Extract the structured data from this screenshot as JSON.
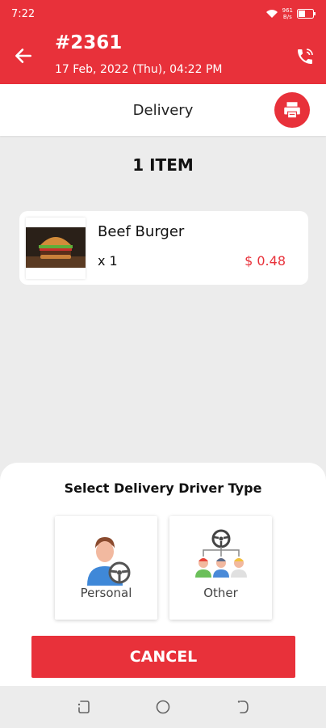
{
  "status_bar": {
    "time": "7:22",
    "speed": "961",
    "speed_unit": "B/s"
  },
  "header": {
    "order_number": "#2361",
    "order_date": "17 Feb, 2022 (Thu), 04:22 PM"
  },
  "subheader": {
    "label": "Delivery"
  },
  "order": {
    "items_count": "1 ITEM",
    "items": [
      {
        "name": "Beef Burger",
        "quantity": "x 1",
        "price": "$ 0.48"
      }
    ]
  },
  "driver_sheet": {
    "title": "Select Delivery Driver Type",
    "options": [
      {
        "label": "Personal"
      },
      {
        "label": "Other"
      }
    ],
    "cancel_label": "CANCEL"
  },
  "colors": {
    "accent": "#e8313a"
  }
}
